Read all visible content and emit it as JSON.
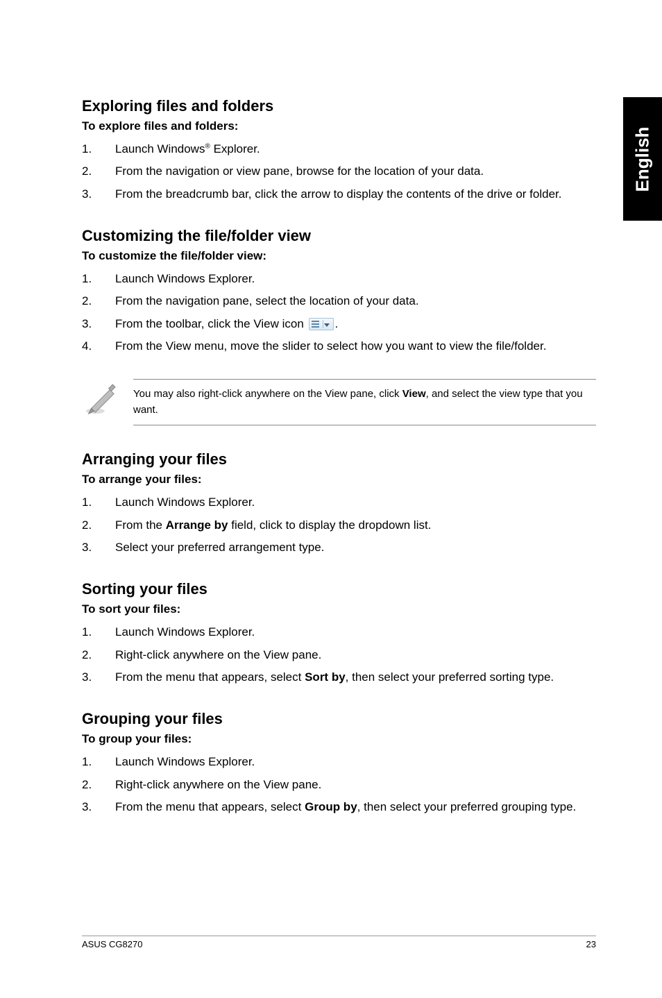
{
  "side_tab": "English",
  "s1": {
    "heading": "Exploring files and folders",
    "sub": "To explore files and folders:",
    "items": [
      {
        "num": "1.",
        "pre": "Launch Windows",
        "sup": "®",
        "post": " Explorer."
      },
      {
        "num": "2.",
        "text": "From the navigation or view pane, browse for the location of your data."
      },
      {
        "num": "3.",
        "text": "From the breadcrumb bar, click the arrow to display the contents of the drive or folder."
      }
    ]
  },
  "s2": {
    "heading": "Customizing the file/folder view",
    "sub": "To customize the file/folder view:",
    "items": [
      {
        "num": "1.",
        "text": "Launch Windows Explorer."
      },
      {
        "num": "2.",
        "text": "From the navigation pane, select the location of your data."
      },
      {
        "num": "3.",
        "pre": "From the toolbar, click the View icon ",
        "icon": true,
        "post": "."
      },
      {
        "num": "4.",
        "text": "From the View menu, move the slider to select how you want to view the file/folder."
      }
    ]
  },
  "note": {
    "pre": "You may also right-click anywhere on the View pane, click ",
    "bold": "View",
    "post": ", and select the view type that you want."
  },
  "s3": {
    "heading": "Arranging your files",
    "sub": "To arrange your files:",
    "items": [
      {
        "num": "1.",
        "text": "Launch Windows Explorer."
      },
      {
        "num": "2.",
        "pre": "From the ",
        "bold": "Arrange by",
        "post": " field, click to display the dropdown list."
      },
      {
        "num": "3.",
        "text": "Select your preferred arrangement type."
      }
    ]
  },
  "s4": {
    "heading": "Sorting your files",
    "sub": "To sort your files:",
    "items": [
      {
        "num": "1.",
        "text": "Launch Windows Explorer."
      },
      {
        "num": "2.",
        "text": "Right-click anywhere on the View pane."
      },
      {
        "num": "3.",
        "pre": "From the menu that appears, select ",
        "bold": "Sort by",
        "post": ", then select your preferred sorting type."
      }
    ]
  },
  "s5": {
    "heading": "Grouping your files",
    "sub": "To group your files:",
    "items": [
      {
        "num": "1.",
        "text": "Launch Windows Explorer."
      },
      {
        "num": "2.",
        "text": "Right-click anywhere on the View pane."
      },
      {
        "num": "3.",
        "pre": "From the menu that appears, select ",
        "bold": "Group by",
        "post": ", then select your preferred grouping type."
      }
    ]
  },
  "footer": {
    "left": "ASUS CG8270",
    "right": "23"
  }
}
